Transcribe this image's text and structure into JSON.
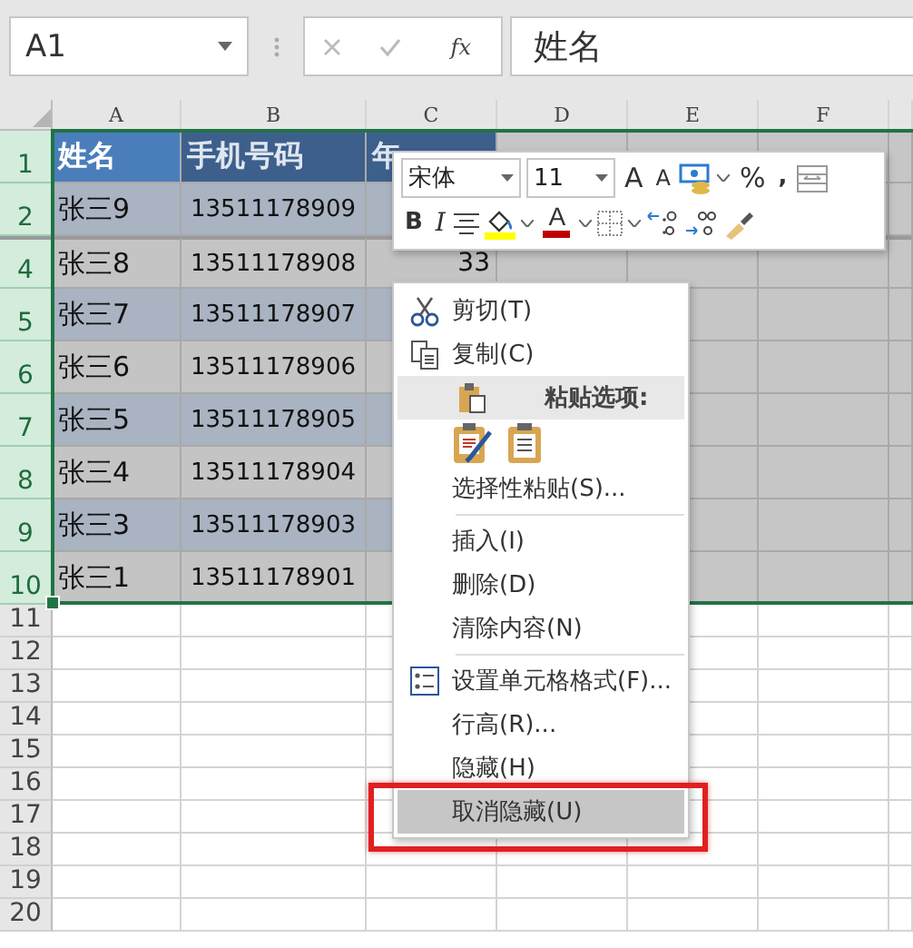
{
  "name_box": {
    "value": "A1"
  },
  "formula_bar": {
    "function_label": "fx",
    "value": "姓名"
  },
  "columns": [
    "A",
    "B",
    "C",
    "D",
    "E",
    "F"
  ],
  "rows": [
    {
      "header": "1",
      "kind": "header",
      "selected": true,
      "cells": [
        "姓名",
        "手机号码",
        "年"
      ]
    },
    {
      "header": "2",
      "kind": "dark",
      "selected": true,
      "cells": [
        "张三9",
        "13511178909"
      ]
    },
    {
      "header": "4",
      "kind": "light",
      "selected": true,
      "after_hidden": true,
      "cells": [
        "张三8",
        "13511178908",
        "33"
      ]
    },
    {
      "header": "5",
      "kind": "dark",
      "selected": true,
      "cells": [
        "张三7",
        "13511178907"
      ]
    },
    {
      "header": "6",
      "kind": "light",
      "selected": true,
      "cells": [
        "张三6",
        "13511178906"
      ]
    },
    {
      "header": "7",
      "kind": "dark",
      "selected": true,
      "cells": [
        "张三5",
        "13511178905"
      ]
    },
    {
      "header": "8",
      "kind": "light",
      "selected": true,
      "cells": [
        "张三4",
        "13511178904"
      ]
    },
    {
      "header": "9",
      "kind": "dark",
      "selected": true,
      "cells": [
        "张三3",
        "13511178903"
      ]
    },
    {
      "header": "10",
      "kind": "light",
      "selected": true,
      "cells": [
        "张三1",
        "13511178901"
      ]
    },
    {
      "header": "11",
      "kind": "empty",
      "selected": false
    },
    {
      "header": "12",
      "kind": "empty",
      "selected": false
    },
    {
      "header": "13",
      "kind": "empty",
      "selected": false
    },
    {
      "header": "14",
      "kind": "empty",
      "selected": false
    },
    {
      "header": "15",
      "kind": "empty",
      "selected": false
    },
    {
      "header": "16",
      "kind": "empty",
      "selected": false
    },
    {
      "header": "17",
      "kind": "empty",
      "selected": false
    },
    {
      "header": "18",
      "kind": "empty",
      "selected": false
    },
    {
      "header": "19",
      "kind": "empty",
      "selected": false
    },
    {
      "header": "20",
      "kind": "empty",
      "selected": false
    }
  ],
  "mini_toolbar": {
    "font": "宋体",
    "size": "11",
    "grow_font": "A",
    "shrink_font": "A",
    "percent": "%",
    "comma": ",",
    "bold": "B",
    "italic": "I",
    "font_color": "A"
  },
  "context_menu": [
    {
      "kind": "cut",
      "label": "剪切(T)",
      "selected": false
    },
    {
      "kind": "copy",
      "label": "复制(C)",
      "selected": false
    },
    {
      "kind": "paste-section",
      "label": "粘贴选项:"
    },
    {
      "kind": "paste-buttons"
    },
    {
      "kind": "command",
      "label": "选择性粘贴(S)...",
      "selected": false
    },
    {
      "kind": "separator"
    },
    {
      "kind": "command",
      "label": "插入(I)",
      "selected": false
    },
    {
      "kind": "command",
      "label": "删除(D)",
      "selected": false
    },
    {
      "kind": "command",
      "label": "清除内容(N)",
      "selected": false
    },
    {
      "kind": "separator"
    },
    {
      "kind": "format",
      "label": "设置单元格格式(F)...",
      "selected": false
    },
    {
      "kind": "command",
      "label": "行高(R)...",
      "selected": false
    },
    {
      "kind": "command",
      "label": "隐藏(H)",
      "selected": false
    },
    {
      "kind": "command",
      "label": "取消隐藏(U)",
      "selected": true,
      "marked": true
    }
  ]
}
